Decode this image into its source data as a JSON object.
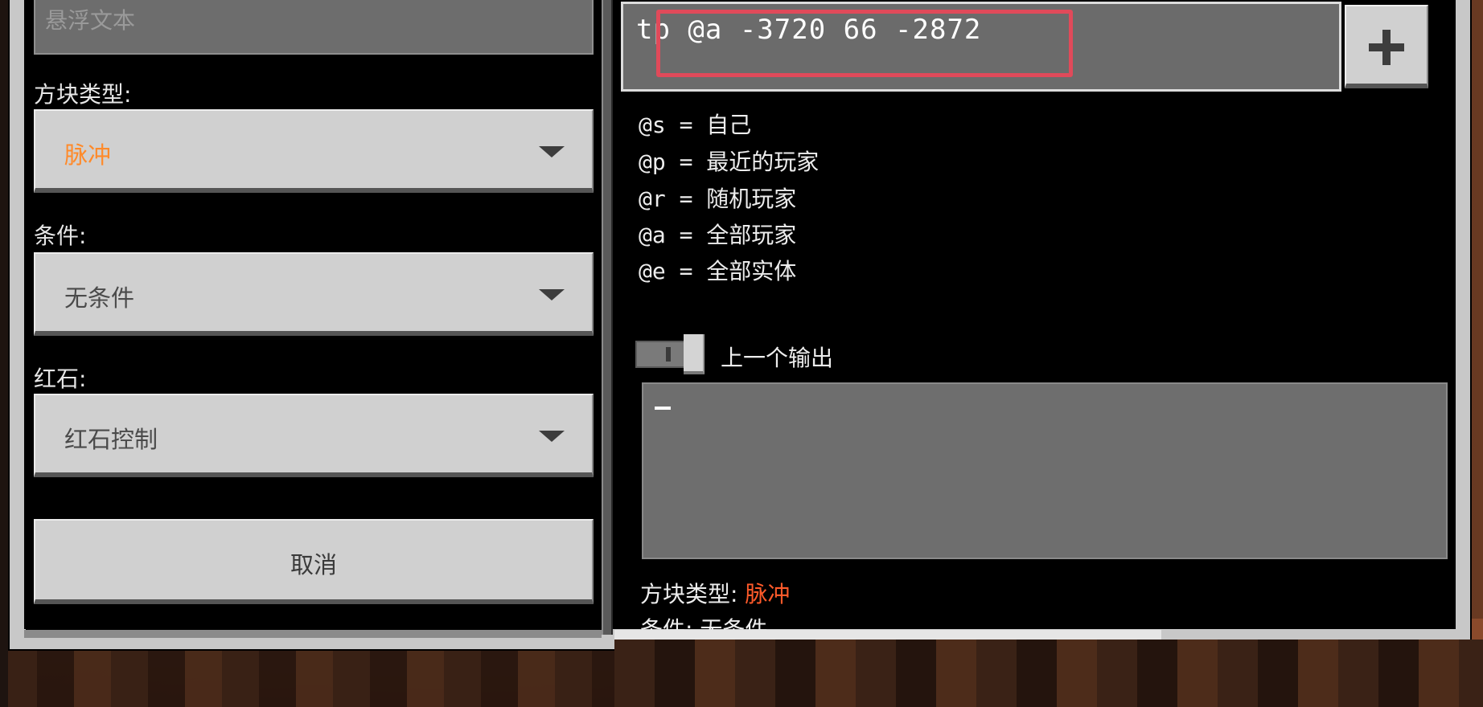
{
  "left": {
    "hover_text_placeholder": "悬浮文本",
    "block_type_label": "方块类型:",
    "block_type_value": "脉冲",
    "condition_label": "条件:",
    "condition_value": "无条件",
    "redstone_label": "红石:",
    "redstone_value": "红石控制",
    "cancel_label": "取消"
  },
  "right": {
    "command_value": "tp @a -3720 66 -2872",
    "selectors": [
      {
        "text": "@s = 自己"
      },
      {
        "text": "@p = 最近的玩家"
      },
      {
        "text": "@r = 随机玩家"
      },
      {
        "text": "@a = 全部玩家"
      },
      {
        "text": "@e = 全部实体"
      }
    ],
    "previous_output_label": "上一个输出",
    "info_block_type_label": "方块类型: ",
    "info_block_type_value": "脉冲",
    "info_condition_label": "条件: ",
    "info_condition_value": "无条件"
  },
  "colors": {
    "accent_orange": "#ff8a2a",
    "highlight_red": "#e04a5a",
    "button_gray": "#d0d0d0",
    "field_gray": "#6b6b6b"
  },
  "icons": {
    "add": "plus-icon",
    "dropdown": "chevron-down-icon"
  }
}
